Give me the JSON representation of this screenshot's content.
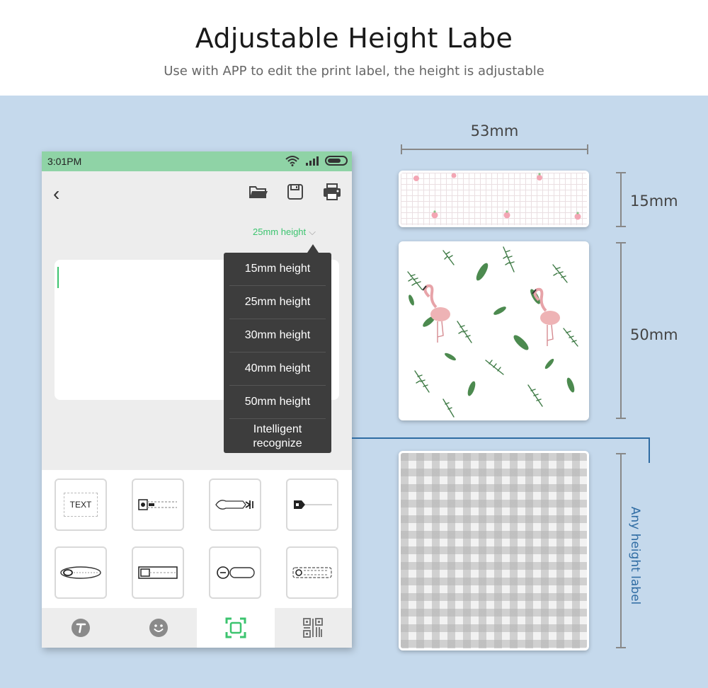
{
  "header": {
    "title": "Adjustable Height Labe",
    "subtitle": "Use with APP to edit the print label, the height is adjustable"
  },
  "phone": {
    "status_time": "3:01PM",
    "height_selector": "25mm height",
    "dropdown": [
      "15mm height",
      "25mm height",
      "30mm height",
      "40mm height",
      "50mm height",
      "Intelligent recognize"
    ],
    "template_text": "TEXT",
    "nav_icons": [
      "text-icon",
      "emoji-icon",
      "frame-icon",
      "qrcode-icon"
    ],
    "accent_color": "#3cc46f",
    "status_color": "#8fd3a6"
  },
  "labels": {
    "width": "53mm",
    "h1": "15mm",
    "h2": "50mm",
    "any": "Any height label"
  }
}
